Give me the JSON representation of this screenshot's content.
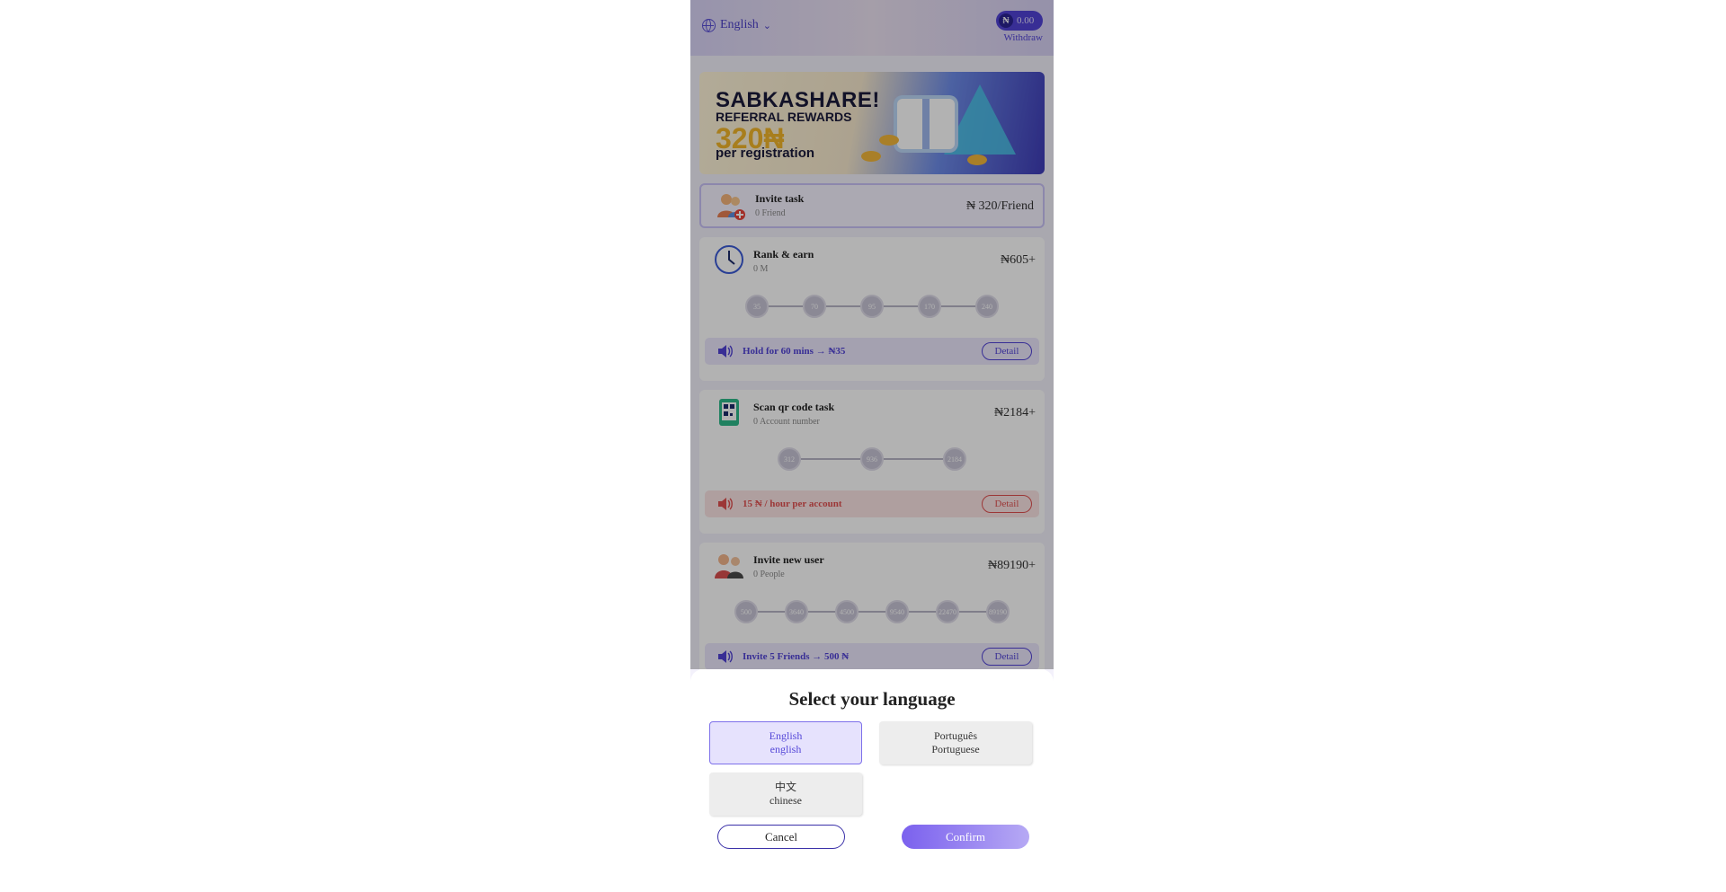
{
  "header": {
    "language_label": "English",
    "balance": "0.00",
    "currency_symbol": "₦",
    "withdraw_label": "Withdraw"
  },
  "banner": {
    "line1": "SABKASHARE!",
    "line2": "REFERRAL REWARDS",
    "line3": "320₦",
    "line4": "per registration"
  },
  "tasks": {
    "invite_task": {
      "title": "Invite task",
      "sub": "0 Friend",
      "amount": "₦ 320/Friend"
    },
    "rank_earn": {
      "title": "Rank & earn",
      "sub": "0 M",
      "amount": "₦605+",
      "steps": [
        "35",
        "70",
        "95",
        "170",
        "240"
      ],
      "notice": "Hold for 60 mins → ₦35",
      "detail": "Detail"
    },
    "scan_qr": {
      "title": "Scan qr code task",
      "sub": "0 Account number",
      "amount": "₦2184+",
      "steps": [
        "312",
        "936",
        "2184"
      ],
      "notice": "15 ₦ / hour per account",
      "detail": "Detail"
    },
    "invite_new": {
      "title": "Invite new user",
      "sub": "0 People",
      "amount": "₦89190+",
      "steps": [
        "500",
        "3640",
        "4500",
        "9540",
        "22470",
        "89190"
      ],
      "notice": "Invite 5 Friends → 500 ₦",
      "detail": "Detail"
    }
  },
  "language_sheet": {
    "title": "Select your language",
    "options": [
      {
        "native": "English",
        "english": "english",
        "selected": true
      },
      {
        "native": "Português",
        "english": "Portuguese",
        "selected": false
      },
      {
        "native": "中文",
        "english": "chinese",
        "selected": false
      }
    ],
    "cancel_label": "Cancel",
    "confirm_label": "Confirm"
  },
  "colors": {
    "accent": "#5143d6",
    "confirm_gradient_start": "#7b61ee",
    "confirm_gradient_end": "#b6a9f4",
    "selected_option_bg": "#e6e2fd",
    "notice_red": "#e05050"
  }
}
